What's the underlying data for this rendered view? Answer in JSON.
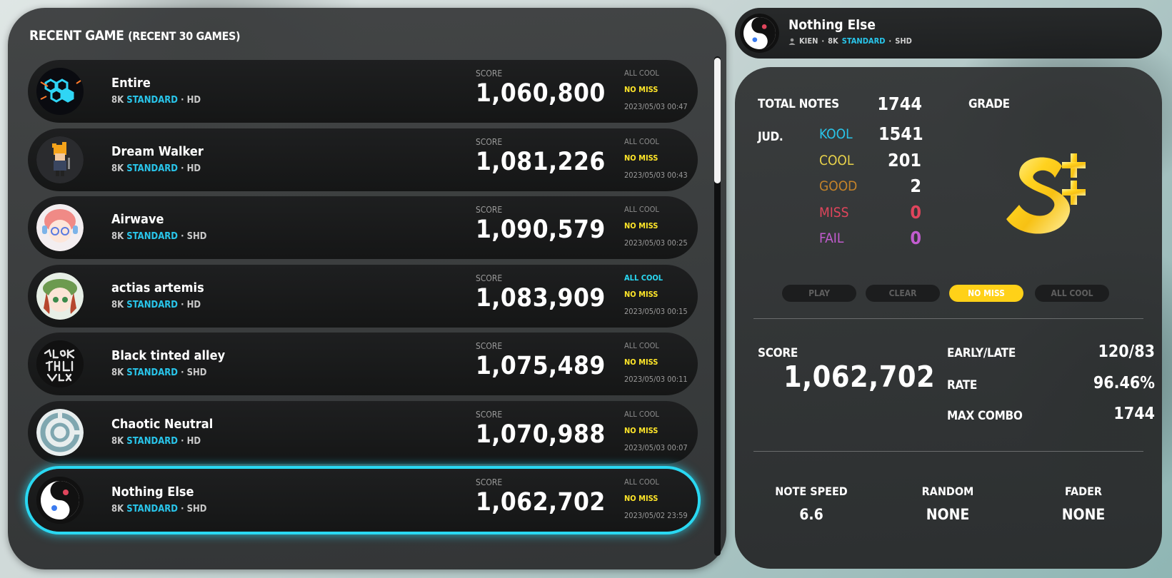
{
  "left": {
    "title_main": "RECENT GAME",
    "title_sub": "(RECENT 30 GAMES)"
  },
  "rows": [
    {
      "title": "Entire",
      "mode": "8K",
      "chart": "STANDARD",
      "tier": "· HD",
      "score_label": "SCORE",
      "score": "1,060,800",
      "all_cool": "ALL COOL",
      "all_cool_active": false,
      "no_miss": "NO MISS",
      "date": "2023/05/03 00:47",
      "jacket": "hexagon-jacket"
    },
    {
      "title": "Dream Walker",
      "mode": "8K",
      "chart": "STANDARD",
      "tier": "· HD",
      "score_label": "SCORE",
      "score": "1,081,226",
      "all_cool": "ALL COOL",
      "all_cool_active": false,
      "no_miss": "NO MISS",
      "date": "2023/05/03 00:43",
      "jacket": "pixel-character-jacket"
    },
    {
      "title": "Airwave",
      "mode": "8K",
      "chart": "STANDARD",
      "tier": "· SHD",
      "score_label": "SCORE",
      "score": "1,090,579",
      "all_cool": "ALL COOL",
      "all_cool_active": false,
      "no_miss": "NO MISS",
      "date": "2023/05/03 00:25",
      "jacket": "anime-girl-jacket"
    },
    {
      "title": "actias artemis",
      "mode": "8K",
      "chart": "STANDARD",
      "tier": "· HD",
      "score_label": "SCORE",
      "score": "1,083,909",
      "all_cool": "ALL COOL",
      "all_cool_active": true,
      "no_miss": "NO MISS",
      "date": "2023/05/03 00:15",
      "jacket": "green-hair-girl-jacket"
    },
    {
      "title": "Black tinted alley",
      "mode": "8K",
      "chart": "STANDARD",
      "tier": "· SHD",
      "score_label": "SCORE",
      "score": "1,075,489",
      "all_cool": "ALL COOL",
      "all_cool_active": false,
      "no_miss": "NO MISS",
      "date": "2023/05/03 00:11",
      "jacket": "graffiti-jacket"
    },
    {
      "title": "Chaotic Neutral",
      "mode": "8K",
      "chart": "STANDARD",
      "tier": "· HD",
      "score_label": "SCORE",
      "score": "1,070,988",
      "all_cool": "ALL COOL",
      "all_cool_active": false,
      "no_miss": "NO MISS",
      "date": "2023/05/03 00:07",
      "jacket": "ring-jacket"
    },
    {
      "title": "Nothing Else",
      "mode": "8K",
      "chart": "STANDARD",
      "tier": "· SHD",
      "score_label": "SCORE",
      "score": "1,062,702",
      "all_cool": "ALL COOL",
      "all_cool_active": false,
      "no_miss": "NO MISS",
      "date": "2023/05/02 23:59",
      "jacket": "yin-yang-jacket",
      "selected": true
    }
  ],
  "header": {
    "title": "Nothing Else",
    "artist": "KIEN",
    "sep": "·",
    "mode": "8K",
    "chart": "STANDARD",
    "tier": "SHD"
  },
  "detail": {
    "total_notes_label": "TOTAL NOTES",
    "total_notes": "1744",
    "grade_label": "GRADE",
    "grade": "S++",
    "jud_label": "JUD.",
    "judgements": [
      {
        "name": "KOOL",
        "value": "1541",
        "name_color": "#29c5ea",
        "value_color": "#ffffff"
      },
      {
        "name": "COOL",
        "value": "201",
        "name_color": "#e8d24a",
        "value_color": "#ffffff"
      },
      {
        "name": "GOOD",
        "value": "2",
        "name_color": "#c4832a",
        "value_color": "#ffffff"
      },
      {
        "name": "MISS",
        "value": "0",
        "name_color": "#e0455c",
        "value_color": "#e0455c"
      },
      {
        "name": "FAIL",
        "value": "0",
        "name_color": "#c25ccf",
        "value_color": "#c25ccf"
      }
    ],
    "badges": [
      {
        "label": "PLAY",
        "active": false
      },
      {
        "label": "CLEAR",
        "active": false
      },
      {
        "label": "NO MISS",
        "active": true
      },
      {
        "label": "ALL COOL",
        "active": false
      }
    ],
    "score_label": "SCORE",
    "score": "1,062,702",
    "early_late_label": "EARLY/LATE",
    "early_late": "120/83",
    "rate_label": "RATE",
    "rate": "96.46%",
    "max_combo_label": "MAX COMBO",
    "max_combo": "1744",
    "options": [
      {
        "label": "NOTE SPEED",
        "value": "6.6"
      },
      {
        "label": "RANDOM",
        "value": "NONE"
      },
      {
        "label": "FADER",
        "value": "NONE"
      }
    ]
  },
  "colors": {
    "accent_cyan": "#29d8f2",
    "standard_blue": "#29c5ea",
    "no_miss_yellow": "#ffe629",
    "badge_active": "#ffd118"
  }
}
